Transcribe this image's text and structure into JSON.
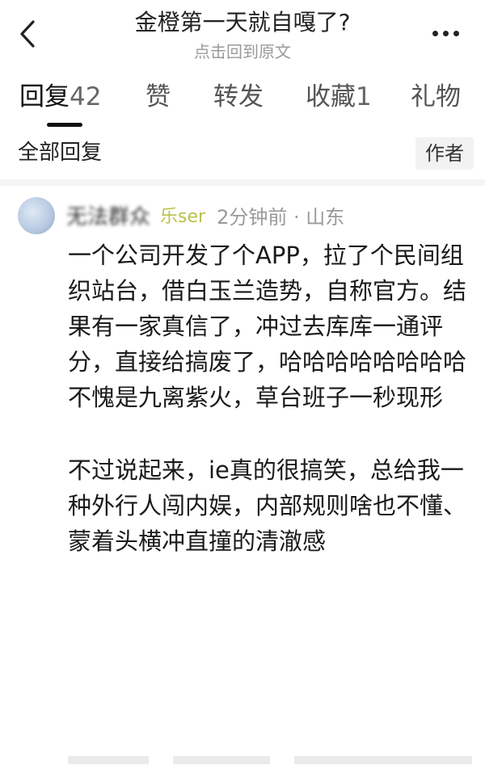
{
  "header": {
    "title": "金橙第一天就自嘎了?",
    "subtitle": "点击回到原文"
  },
  "tabs": [
    {
      "label": "回复",
      "count": "42",
      "active": true
    },
    {
      "label": "赞",
      "count": ""
    },
    {
      "label": "转发",
      "count": ""
    },
    {
      "label": "收藏",
      "count": "1"
    },
    {
      "label": "礼物",
      "count": ""
    }
  ],
  "filter": {
    "label": "全部回复",
    "author_chip": "作者"
  },
  "comment": {
    "username": "无法群众",
    "badge": "乐ser",
    "time": "2分钟前 · 山东",
    "paragraphs": [
      "一个公司开发了个APP，拉了个民间组织站台，借白玉兰造势，自称官方。结果有一家真信了，冲过去库库一通评分，直接给搞废了，哈哈哈哈哈哈哈哈",
      "不愧是九离紫火，草台班子一秒现形",
      "不过说起来，ie真的很搞笑，总给我一种外行人闯内娱，内部规则啥也不懂、蒙着头横冲直撞的清澈感"
    ]
  },
  "icons": {
    "back": "chevron-left-icon",
    "more": "more-dots-icon"
  }
}
